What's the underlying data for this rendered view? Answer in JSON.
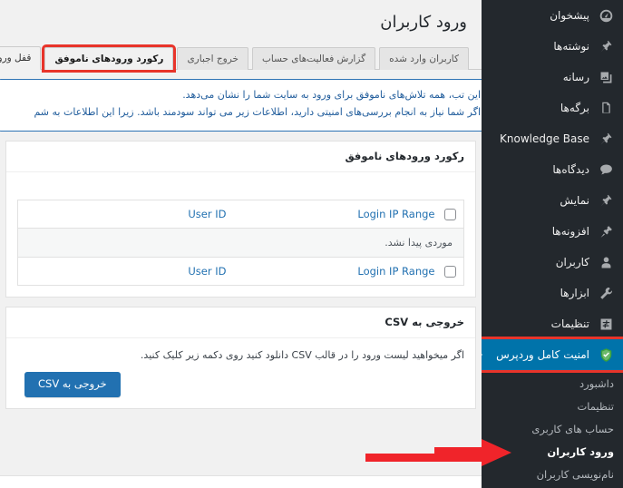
{
  "page": {
    "title": "ورود کاربران"
  },
  "tabs": [
    {
      "label": "کاربران وارد شده",
      "state": "inactive"
    },
    {
      "label": "گزارش فعالیت‌های حساب",
      "state": "inactive"
    },
    {
      "label": "خروج اجباری",
      "state": "inactive"
    },
    {
      "label": "رکورد ورودهای ناموفق",
      "state": "highlighted"
    },
    {
      "label": "قفل ورود",
      "state": "active"
    }
  ],
  "notice": {
    "line1": "این تب، همه تلاش‌های ناموفق برای ورود به سایت شما را نشان می‌دهد.",
    "line2": "اگر شما نیاز به انجام بررسی‌های امنیتی دارید، اطلاعات زیر می تواند سودمند باشد. زیرا این اطلاعات به شم"
  },
  "failed_logins_panel": {
    "title": "رکورد ورودهای ناموفق",
    "table": {
      "columns": [
        "",
        "Login IP Range",
        "User ID"
      ],
      "no_items_text": "موردی پیدا نشد.",
      "rows": []
    }
  },
  "csv_panel": {
    "title": "خروجی به CSV",
    "description": "اگر میخواهید لیست ورود را در قالب CSV دانلود کنید روی دکمه زیر کلیک کنید.",
    "button_label": "خروجی به CSV"
  },
  "sidebar": {
    "items": [
      {
        "label": "پیشخوان",
        "icon": "dashboard-icon"
      },
      {
        "label": "نوشته‌ها",
        "icon": "pin-icon"
      },
      {
        "label": "رسانه",
        "icon": "media-icon"
      },
      {
        "label": "برگه‌ها",
        "icon": "pages-icon"
      },
      {
        "label": "Knowledge Base",
        "icon": "pin-icon"
      },
      {
        "label": "دیدگاه‌ها",
        "icon": "comment-icon"
      },
      {
        "label": "نمایش",
        "icon": "appearance-icon"
      },
      {
        "label": "افزونه‌ها",
        "icon": "plugin-icon"
      },
      {
        "label": "کاربران",
        "icon": "users-icon"
      },
      {
        "label": "ابزارها",
        "icon": "tools-icon"
      },
      {
        "label": "تنظیمات",
        "icon": "settings-icon"
      }
    ],
    "current_item": {
      "label": "امنیت کامل وردپرس",
      "icon": "shield-check-icon"
    },
    "submenu": [
      {
        "label": "داشبورد",
        "current": false
      },
      {
        "label": "تنظیمات",
        "current": false
      },
      {
        "label": "حساب های کاربری",
        "current": false
      },
      {
        "label": "ورود کاربران",
        "current": true
      },
      {
        "label": "نام‌نویسی کاربران",
        "current": false
      }
    ]
  },
  "annotations": {
    "highlight_color": "#e8342a",
    "arrow_color": "#f0242a",
    "accent_color": "#2271b1",
    "menu_active_color": "#0073aa"
  }
}
